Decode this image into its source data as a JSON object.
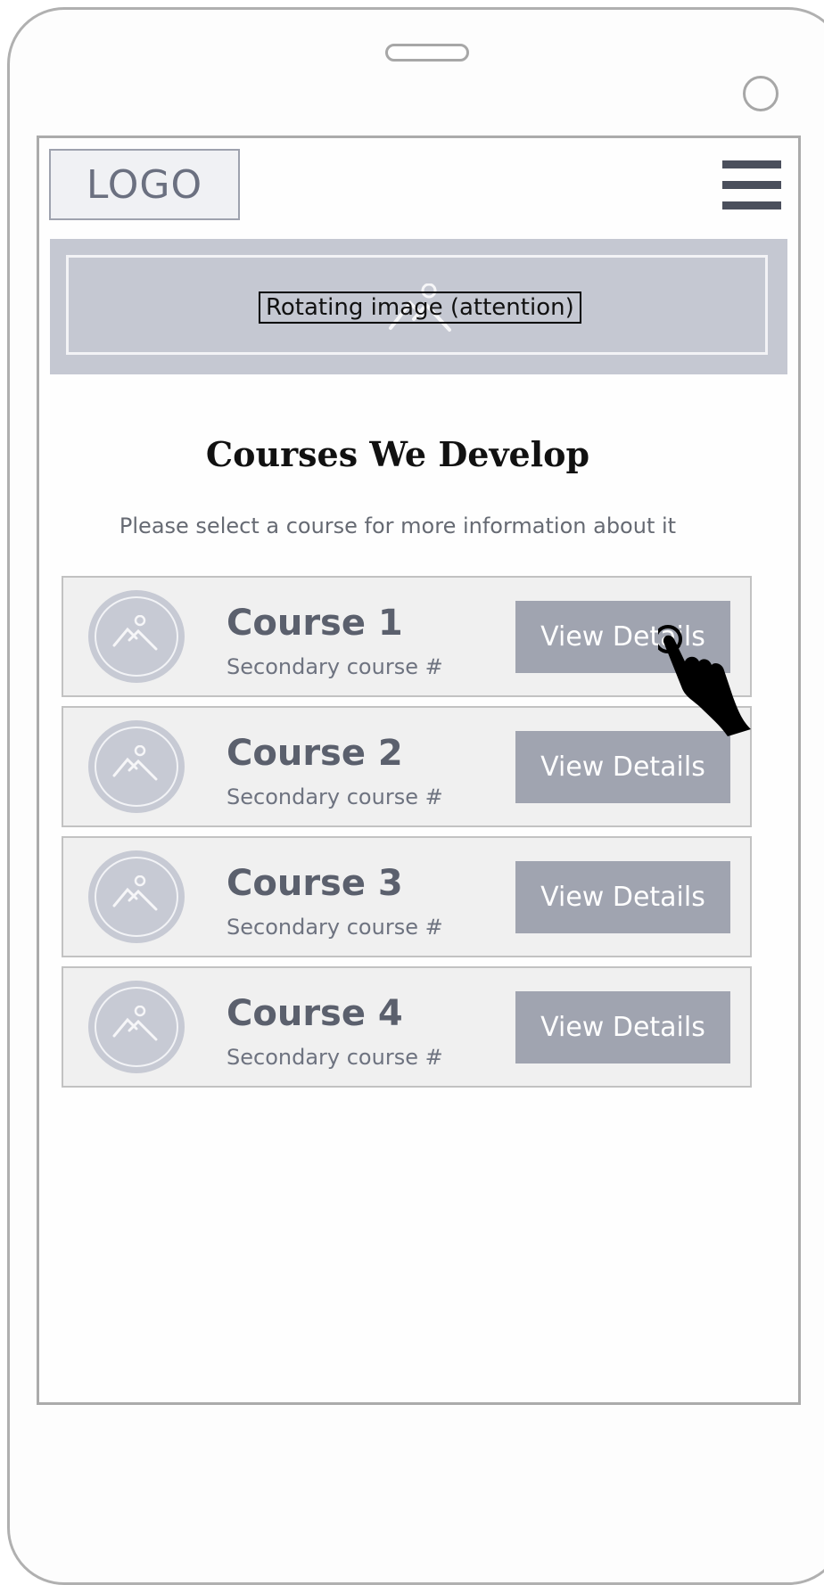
{
  "header": {
    "logo_text": "LOGO",
    "menu_icon": "hamburger-menu-icon"
  },
  "banner": {
    "label": "Rotating image (attention)",
    "icon": "image-placeholder-icon"
  },
  "main": {
    "title": "Courses We Develop",
    "subtitle": "Please select a course for more information about it"
  },
  "courses": [
    {
      "name": "Course 1",
      "secondary": "Secondary course #",
      "button_label": "View Details"
    },
    {
      "name": "Course 2",
      "secondary": "Secondary course #",
      "button_label": "View Details"
    },
    {
      "name": "Course 3",
      "secondary": "Secondary course #",
      "button_label": "View Details"
    },
    {
      "name": "Course 4",
      "secondary": "Secondary course #",
      "button_label": "View Details"
    }
  ],
  "overlay": {
    "cursor_icon": "hand-pointer-icon"
  },
  "colors": {
    "button_bg": "#a0a4b0",
    "card_bg": "#f0f0f0",
    "banner_bg": "#c5c8d2",
    "menu_bars": "#4a4f5c"
  }
}
